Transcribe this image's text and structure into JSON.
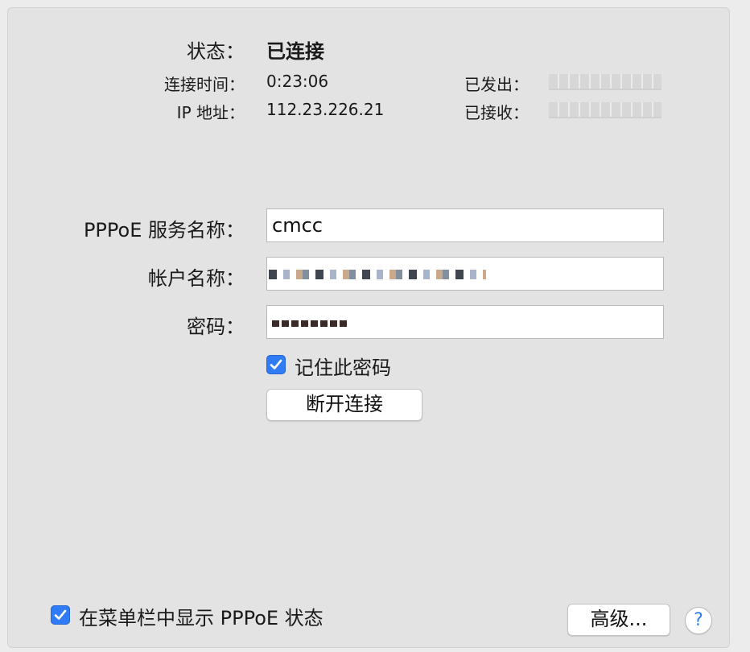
{
  "status": {
    "label": "状态：",
    "value": "已连接"
  },
  "details": {
    "connect_time_label": "连接时间：",
    "connect_time_value": "0:23:06",
    "ip_label": "IP 地址：",
    "ip_value": "112.23.226.21",
    "sent_label": "已发出：",
    "received_label": "已接收："
  },
  "form": {
    "service_name_label": "PPPoE 服务名称：",
    "service_name_value": "cmcc",
    "account_label": "帐户名称：",
    "password_label": "密码：",
    "remember_password_label": "记住此密码",
    "remember_password_checked": true
  },
  "buttons": {
    "disconnect": "断开连接",
    "advanced": "高级...",
    "help": "?"
  },
  "footer": {
    "show_in_menubar_label": "在菜单栏中显示 PPPoE 状态",
    "show_in_menubar_checked": true
  },
  "colors": {
    "accent": "#2f7cf6",
    "panel_bg": "#e3e3e3",
    "window_bg": "#ececec"
  }
}
